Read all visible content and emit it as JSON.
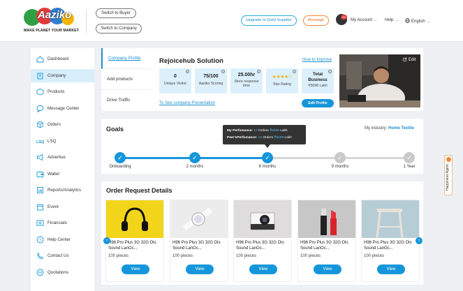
{
  "brand": {
    "name": "Aaziko",
    "tagline": "MAKE PLANET YOUR MARKET"
  },
  "header": {
    "switch_buyer": "Switch to Buyer",
    "switch_company": "Switch to Company",
    "upgrade": "Upgrade to Gold Supplier",
    "message": "Message",
    "notification_count": "99",
    "account": "My Account",
    "help": "Help",
    "language": "English"
  },
  "sidebar": {
    "items": [
      {
        "label": "Dashboard",
        "icon": "home-icon"
      },
      {
        "label": "Company",
        "icon": "company-icon",
        "active": true
      },
      {
        "label": "Products",
        "icon": "products-icon"
      },
      {
        "label": "Message Center",
        "icon": "chat-icon"
      },
      {
        "label": "Orders",
        "icon": "orders-icon"
      },
      {
        "label": "LSQ",
        "icon": "lsq-icon"
      },
      {
        "label": "Advertise",
        "icon": "advertise-icon"
      },
      {
        "label": "Wallet",
        "icon": "wallet-icon"
      },
      {
        "label": "Reports/Analytics",
        "icon": "reports-icon"
      },
      {
        "label": "Event",
        "icon": "event-icon"
      },
      {
        "label": "Financials",
        "icon": "financials-icon"
      },
      {
        "label": "Help Center",
        "icon": "help-icon"
      },
      {
        "label": "Contact Us",
        "icon": "contact-icon"
      },
      {
        "label": "Quotations",
        "icon": "quotations-icon"
      }
    ]
  },
  "profile": {
    "tabs": [
      "Company Profile",
      "Add products",
      "Drive Traffic"
    ],
    "company_name": "Rejoicehub Solution",
    "how_to_improve": "How to Improve",
    "stats": [
      {
        "value": "0",
        "label": "Unique Visitor"
      },
      {
        "value": "75/100",
        "label": "Aaziko Scoring"
      },
      {
        "value": "25.00hr",
        "label": "Store response time"
      },
      {
        "value": "★★★★☆",
        "label": "Star Rating",
        "rating": 4
      },
      {
        "value": "Total Business",
        "label": "₹5698 Lakh"
      }
    ],
    "presentation_link": "To See company Presentation",
    "edit_profile": "Edit Profile",
    "edit_link": "Edit"
  },
  "goals": {
    "title": "Goals",
    "industry_label": "My industry:",
    "industry_value": "Home Textile",
    "tooltip": {
      "line1_label": "My Perfomance:",
      "line1_orders": "10",
      "line1_orders_label": "Orders",
      "line1_amount": "₹5698",
      "line1_unit": "Lakh",
      "line2_label": "Peer'sPerfomance:",
      "line2_orders": "10",
      "line2_orders_label": "Orders",
      "line2_amount": "₹5698",
      "line2_unit": "Lakh"
    },
    "milestones": [
      {
        "label": "Onboarding",
        "done": true
      },
      {
        "label": "2 months",
        "done": true
      },
      {
        "label": "6 months",
        "done": true
      },
      {
        "label": "9 months",
        "done": false
      },
      {
        "label": "1 Year",
        "done": false
      }
    ]
  },
  "orders": {
    "title": "Order Request Details",
    "items": [
      {
        "title": "H96 Pro Plus 3G 32G Dts Sound LanOc...",
        "qty": "100 pieces",
        "view": "View",
        "image": "headphones"
      },
      {
        "title": "H96 Pro Plus 3G 32G Dts Sound LanOc...",
        "qty": "100 pieces",
        "view": "View",
        "image": "smartwatch"
      },
      {
        "title": "H96 Pro Plus 3G 32G Dts Sound LanOc...",
        "qty": "100 pieces",
        "view": "View",
        "image": "camera"
      },
      {
        "title": "H96 Pro Plus 3G 32G Dts Sound LanOc...",
        "qty": "100 pieces",
        "view": "View",
        "image": "lipstick"
      },
      {
        "title": "H96 Pro Plus 3G 32G Dts Sound LanOc...",
        "qty": "100 pieces",
        "view": "View",
        "image": "stool"
      }
    ]
  },
  "happiness_agent": "Happiness Agent",
  "colors": {
    "accent": "#1596da",
    "active_bg": "#d9eefb",
    "page_bg": "#eef0f4"
  }
}
